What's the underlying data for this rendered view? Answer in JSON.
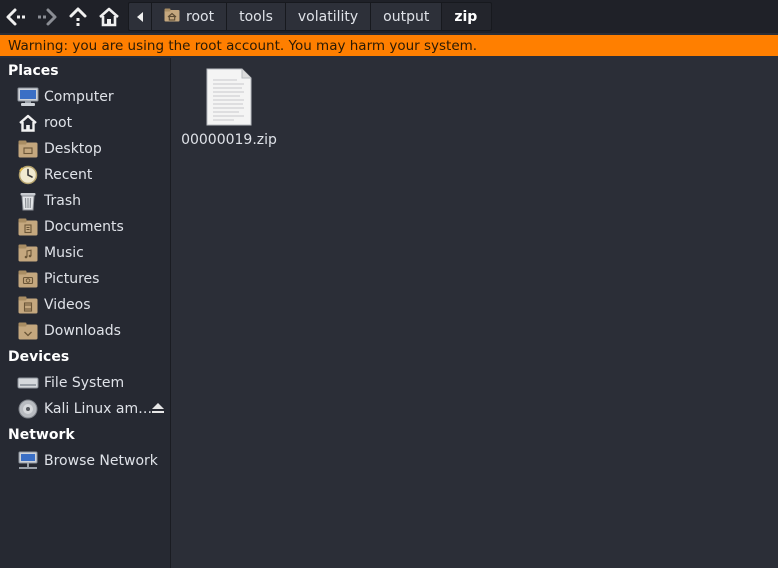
{
  "toolbar": {
    "back_icon": "back-arrow-icon",
    "forward_icon": "forward-arrow-icon",
    "up_icon": "up-arrow-icon",
    "home_icon": "home-icon"
  },
  "path": {
    "crumbs": [
      "root",
      "tools",
      "volatility",
      "output",
      "zip"
    ]
  },
  "warning": {
    "text": "Warning: you are using the root account. You may harm your system."
  },
  "sidebar": {
    "places_title": "Places",
    "places": [
      {
        "label": "Computer",
        "icon": "computer-icon"
      },
      {
        "label": "root",
        "icon": "home-icon"
      },
      {
        "label": "Desktop",
        "icon": "desktop-folder-icon"
      },
      {
        "label": "Recent",
        "icon": "clock-icon"
      },
      {
        "label": "Trash",
        "icon": "trash-icon"
      },
      {
        "label": "Documents",
        "icon": "documents-folder-icon"
      },
      {
        "label": "Music",
        "icon": "music-folder-icon"
      },
      {
        "label": "Pictures",
        "icon": "pictures-folder-icon"
      },
      {
        "label": "Videos",
        "icon": "videos-folder-icon"
      },
      {
        "label": "Downloads",
        "icon": "downloads-folder-icon"
      }
    ],
    "devices_title": "Devices",
    "devices": [
      {
        "label": "File System",
        "icon": "drive-icon"
      },
      {
        "label": "Kali Linux am…",
        "icon": "disc-icon"
      }
    ],
    "network_title": "Network",
    "network": [
      {
        "label": "Browse Network",
        "icon": "network-icon"
      }
    ]
  },
  "files": [
    {
      "name": "00000019.zip",
      "icon": "document-file-icon"
    }
  ],
  "colors": {
    "warning_bg": "#ff7f00",
    "sidebar_bg": "#262932",
    "main_bg": "#2b2e37",
    "folder": "#c4a77e"
  }
}
